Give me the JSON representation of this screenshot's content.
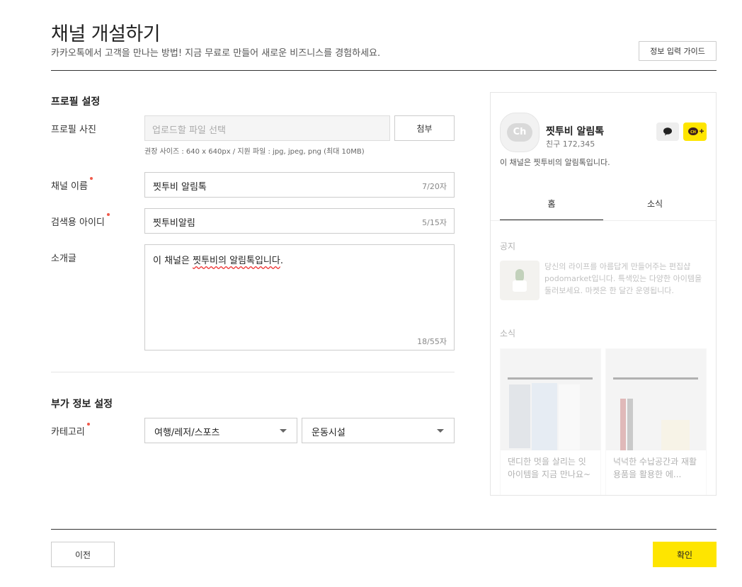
{
  "header": {
    "title": "채널 개설하기",
    "subtitle": "카카오톡에서 고객을 만나는 방법! 지금 무료로 만들어 새로운 비즈니스를 경험하세요.",
    "guide_button": "정보 입력 가이드"
  },
  "profile_section": {
    "title": "프로필 설정",
    "photo_label": "프로필 사진",
    "photo_placeholder": "업로드할 파일 선택",
    "attach_button": "첨부",
    "photo_hint": "권장 사이즈 : 640 x 640px / 지원 파일 : jpg, jpeg, png (최대 10MB)",
    "channel_name_label": "채널 이름",
    "channel_name_value": "찟투비 알림톡",
    "channel_name_counter": "7/20자",
    "search_id_label": "검색용 아이디",
    "search_id_value": "찟투비알림",
    "search_id_counter": "5/15자",
    "intro_label": "소개글",
    "intro_prefix": "이 채널은 ",
    "intro_squiggle": "찟투비의 알림톡입니다",
    "intro_suffix": ".",
    "intro_counter": "18/55자"
  },
  "extra_section": {
    "title": "부가 정보 설정",
    "category_label": "카테고리",
    "category_main": "여행/레저/스포츠",
    "category_sub": "운동시설"
  },
  "preview": {
    "logo_text": "Ch",
    "name": "찟투비 알림톡",
    "friends": "친구 172,345",
    "desc": "이 채널은 찟투비의 알림톡입니다.",
    "tabs": [
      "홈",
      "소식"
    ],
    "notice_title": "공지",
    "notice_text": "당신의 라이프를 아름답게 만들어주는 편집샵 podomarket입니다. 특색있는 다양한 아이템을 둘러보세요. 마켓은 한 달간 운영됩니다.",
    "news_title": "소식",
    "cards": [
      {
        "caption": "댄디한 멋을 살리는 잇 아이템을 지금 만나요~"
      },
      {
        "caption": "넉넉한 수납공간과 재활용품을 활용한 에..."
      }
    ],
    "accent": "#fee500"
  },
  "footer": {
    "prev_button": "이전",
    "confirm_button": "확인"
  },
  "colors": {
    "required_dot": "#f05a4b",
    "confirm_bg": "#fee500"
  }
}
